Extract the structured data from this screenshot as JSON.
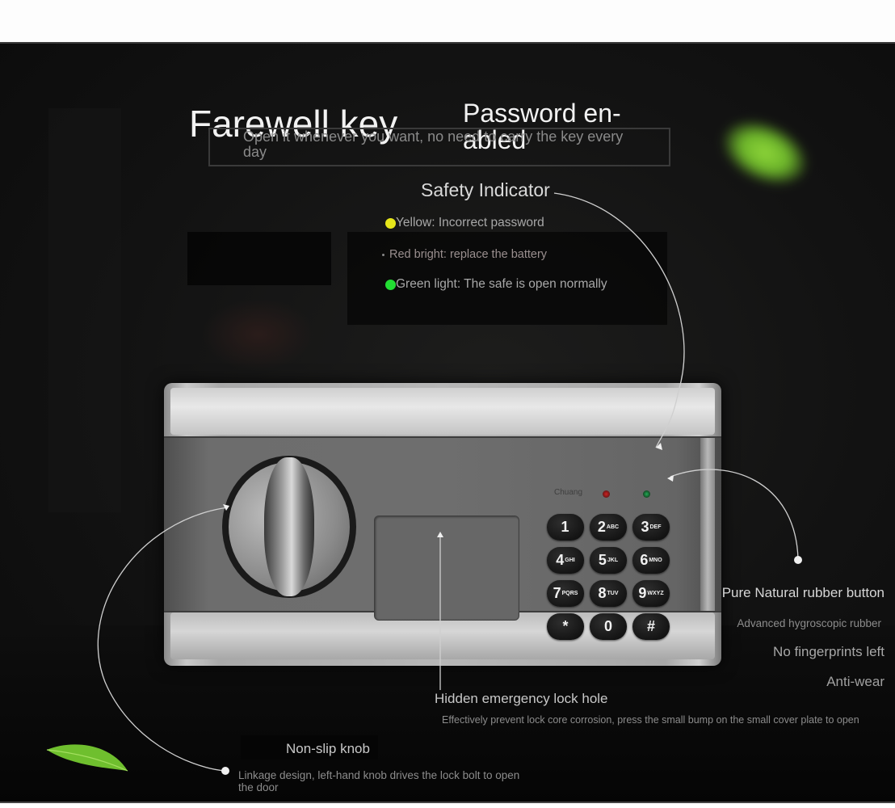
{
  "headline": {
    "title": "Farewell key",
    "subtitle": "Password en- abled",
    "description": "Open it whenever you want, no need to carry the key every day"
  },
  "safety_indicator": {
    "title": "Safety Indicator",
    "items": [
      {
        "label": "Yellow: Incorrect password",
        "color": "#e6e61a",
        "icon": "yellow-dot"
      },
      {
        "label": "Red bright: replace the battery",
        "color": "#8a8a8a",
        "icon": "small-dot"
      },
      {
        "label": "Green light: The safe is open normally",
        "color": "#22dd33",
        "icon": "green-dot"
      }
    ]
  },
  "safe": {
    "brand": "Chuang",
    "keys": [
      {
        "digit": "1",
        "letters": ""
      },
      {
        "digit": "2",
        "letters": "ABC"
      },
      {
        "digit": "3",
        "letters": "DEF"
      },
      {
        "digit": "4",
        "letters": "GHI"
      },
      {
        "digit": "5",
        "letters": "JKL"
      },
      {
        "digit": "6",
        "letters": "MNO"
      },
      {
        "digit": "7",
        "letters": "PQRS"
      },
      {
        "digit": "8",
        "letters": "TUV"
      },
      {
        "digit": "9",
        "letters": "WXYZ"
      },
      {
        "digit": "*",
        "letters": ""
      },
      {
        "digit": "0",
        "letters": ""
      },
      {
        "digit": "#",
        "letters": ""
      }
    ]
  },
  "rubber_button": {
    "title": "Pure Natural rubber button",
    "features": [
      "Advanced hygroscopic rubber",
      "No fingerprints left",
      "Anti-wear"
    ]
  },
  "emergency_lock": {
    "title": "Hidden emergency lock hole",
    "description": "Effectively prevent lock core corrosion, press the small bump on the small cover plate to open"
  },
  "knob": {
    "title": "Non-slip knob",
    "description": "Linkage design, left-hand knob drives the lock bolt to open the door"
  },
  "colors": {
    "background": "#121212",
    "accent_leaf": "#7cc630",
    "text_primary": "#f2f2f2",
    "text_secondary": "#8c8c8c"
  }
}
